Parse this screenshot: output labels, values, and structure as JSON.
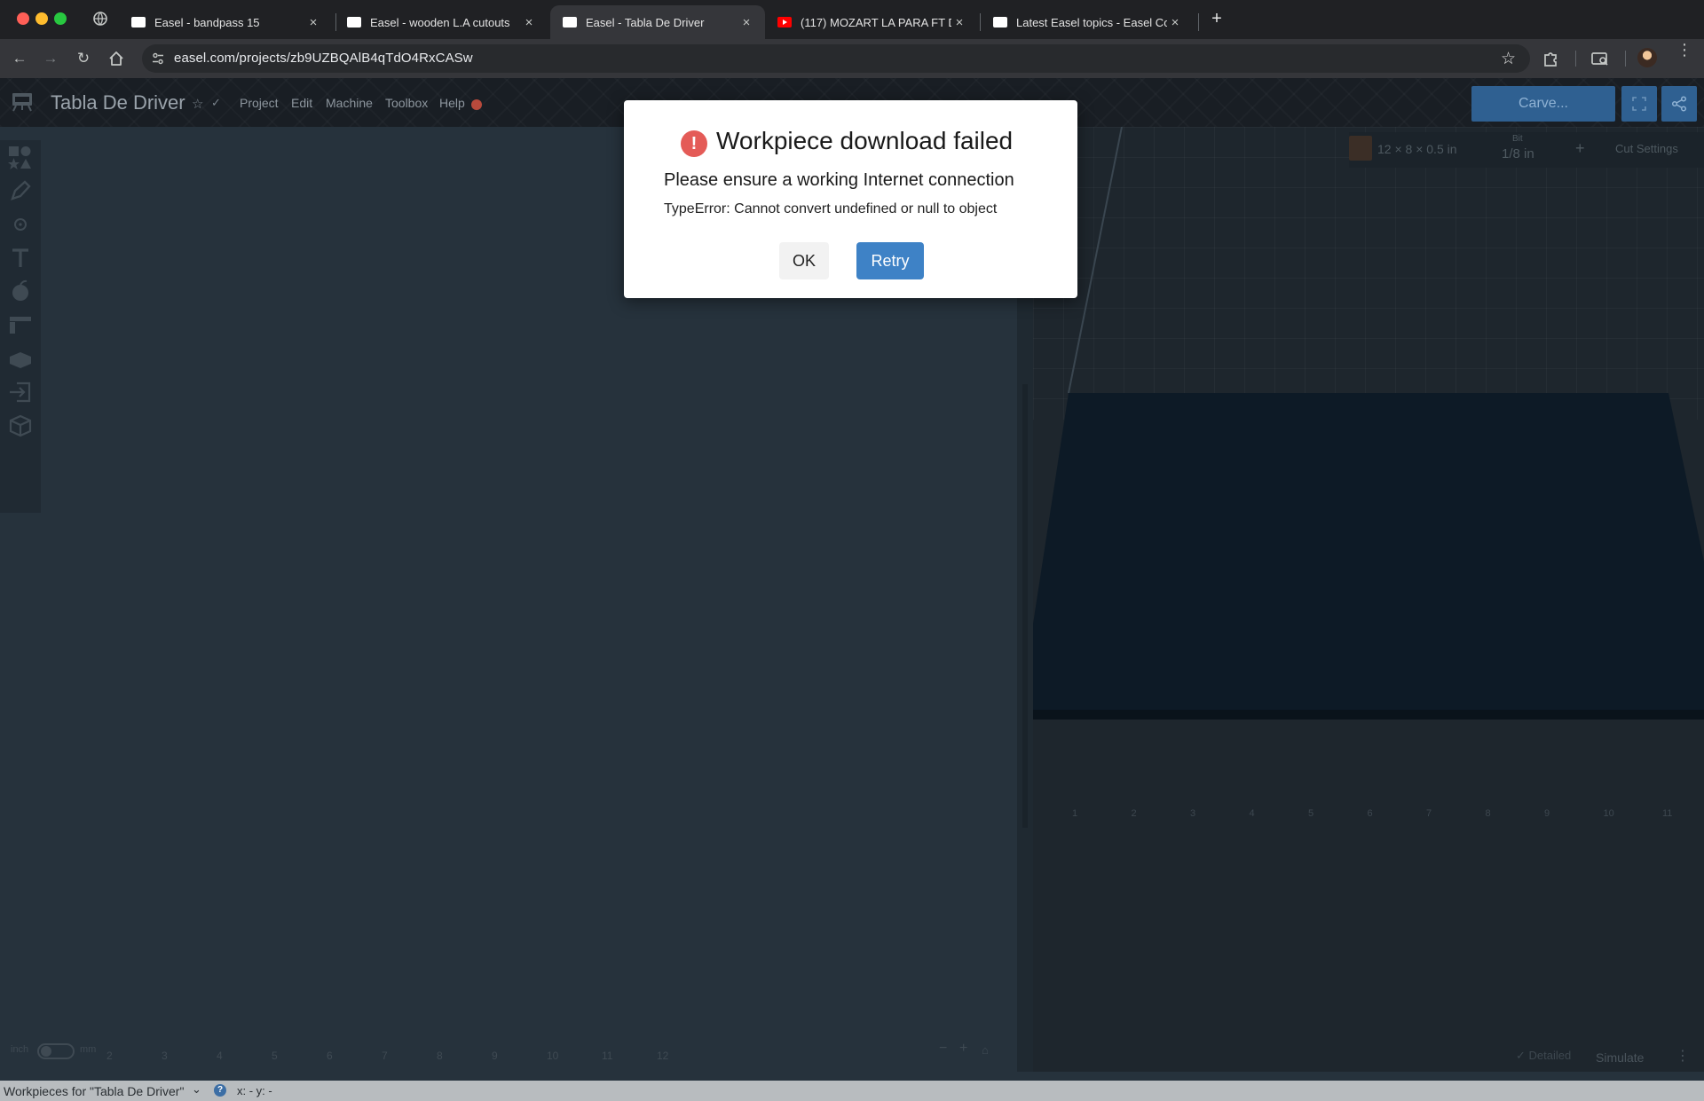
{
  "browser": {
    "tabs": [
      {
        "title": "Easel - bandpass 15",
        "favicon": "page-icon"
      },
      {
        "title": "Easel - wooden L.A cutouts",
        "favicon": "page-icon"
      },
      {
        "title": "Easel - Tabla De Driver",
        "favicon": "page-icon",
        "active": true
      },
      {
        "title": "(117) MOZART LA PARA FT D",
        "favicon": "youtube-icon"
      },
      {
        "title": "Latest Easel topics - Easel Co",
        "favicon": "page-icon"
      }
    ],
    "tab_close": "×",
    "new_tab": "+",
    "url": "easel.com/projects/zb9UZBQAlB4qTdO4RxCASw",
    "accent_color": "#ff5f57"
  },
  "app": {
    "project_title": "Tabla De Driver",
    "menu": [
      "Project",
      "Edit",
      "Machine",
      "Toolbox",
      "Help"
    ],
    "carve_label": "Carve...",
    "material": {
      "dimensions": "12 × 8 × 0.5 in",
      "bit_label": "Bit",
      "bit_size": "1/8 in",
      "add": "+",
      "cut_settings": "Cut Settings"
    },
    "canvas_ticks": [
      "2",
      "3",
      "4",
      "5",
      "6",
      "7",
      "8",
      "9",
      "10",
      "11",
      "12"
    ],
    "preview_ticks": [
      "1",
      "2",
      "3",
      "4",
      "5",
      "6",
      "7",
      "8",
      "9",
      "10",
      "11"
    ],
    "units": {
      "left": "inch",
      "right": "mm"
    },
    "zoom_out": "−",
    "zoom_in": "+",
    "detailed_label": "Detailed",
    "simulate_label": "Simulate",
    "status": {
      "workpieces_label": "Workpieces for \"Tabla De Driver\"",
      "help": "?",
      "coords": "x: - y: -"
    },
    "preview_color": "#0d1a26"
  },
  "modal": {
    "title": "Workpiece download failed",
    "message": "Please ensure a working Internet connection",
    "error": "TypeError: Cannot convert undefined or null to object",
    "icon_glyph": "!",
    "ok_label": "OK",
    "retry_label": "Retry",
    "alert_color": "#e45b57",
    "primary_color": "#3e82c6"
  }
}
